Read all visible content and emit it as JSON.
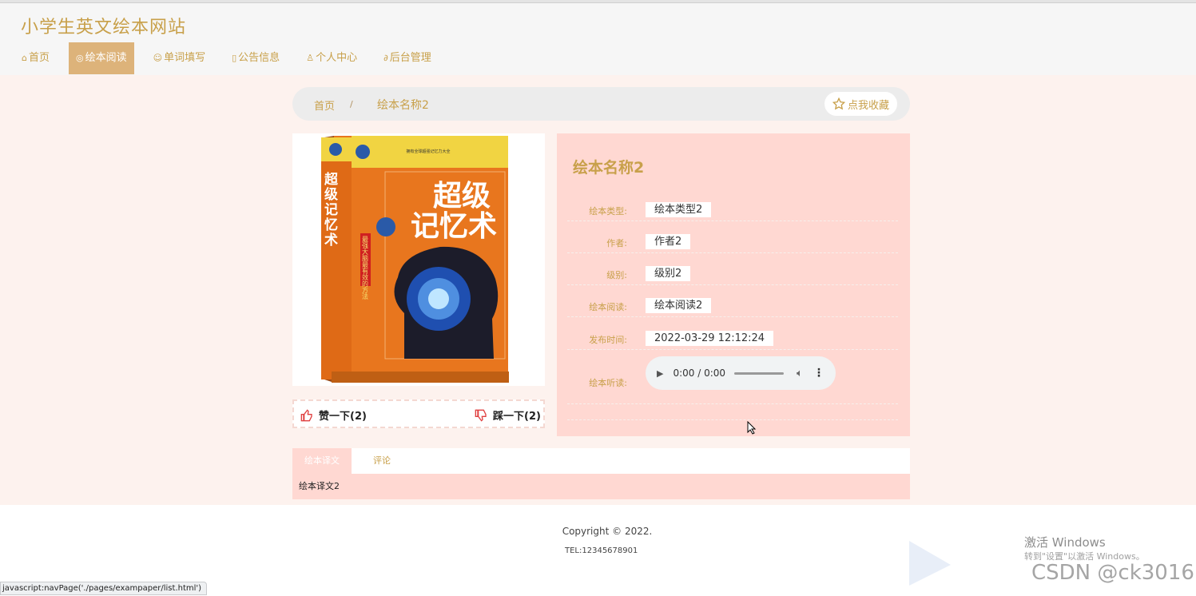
{
  "site": {
    "title": "小学生英文绘本网站"
  },
  "nav": {
    "items": [
      {
        "label": "首页",
        "icon": "home-icon"
      },
      {
        "label": "绘本阅读",
        "icon": "eye-icon",
        "active": true
      },
      {
        "label": "单词填写",
        "icon": "face-icon"
      },
      {
        "label": "公告信息",
        "icon": "document-icon"
      },
      {
        "label": "个人中心",
        "icon": "user-icon"
      },
      {
        "label": "后台管理",
        "icon": "link-icon"
      }
    ]
  },
  "breadcrumb": {
    "home": "首页",
    "separator": "/",
    "current": "绘本名称2"
  },
  "favorite": {
    "label": "点我收藏",
    "icon": "star-icon"
  },
  "cover": {
    "vertical_title": "超级记忆术",
    "title_line1": "超级",
    "title_line2": "记忆术",
    "top_text": "拥有全球超强记忆力大全",
    "red_label": "最强大脑最有效的方法"
  },
  "vote": {
    "like": "赞一下(2)",
    "dislike": "踩一下(2)"
  },
  "detail": {
    "name": "绘本名称2",
    "fields": [
      {
        "label": "绘本类型:",
        "value": "绘本类型2"
      },
      {
        "label": "作者:",
        "value": "作者2"
      },
      {
        "label": "级别:",
        "value": "级别2"
      },
      {
        "label": "绘本阅读:",
        "value": "绘本阅读2"
      },
      {
        "label": "发布时间:",
        "value": "2022-03-29 12:12:24"
      }
    ],
    "audio_label": "绘本听读:",
    "audio_time": "0:00 / 0:00"
  },
  "tabs": {
    "items": [
      {
        "label": "绘本译文",
        "active": true
      },
      {
        "label": "评论",
        "active": false
      }
    ],
    "panel": "绘本译文2"
  },
  "footer": {
    "copyright": "Copyright © 2022.",
    "tel": "TEL:12345678901"
  },
  "status_bar": {
    "url": "javascript:navPage('./pages/exampaper/list.html')"
  },
  "watermark": {
    "line1": "激活 Windows",
    "line2": "转到\"设置\"以激活 Windows。",
    "csdn": "CSDN @ck3016"
  },
  "colors": {
    "accent": "#c8a04a",
    "nav_active": "#ddb37a",
    "panel_bg": "#ffd8d2",
    "page_bg": "#fdf2ee"
  }
}
